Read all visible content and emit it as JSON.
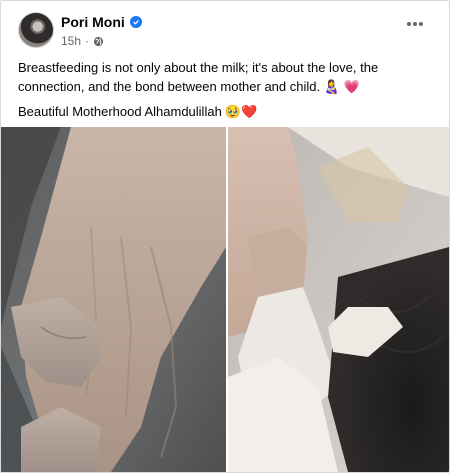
{
  "post": {
    "author": "Pori Moni",
    "timestamp": "15h",
    "audience_icon": "globe-icon",
    "verified_color": "#1877f2",
    "text_line1": "Breastfeeding is not only about the milk; it's about the love, the connection, and the bond between mother and child.",
    "text_line1_emojis": "👩‍🍼 💗",
    "text_line2": "Beautiful Motherhood Alhamdulillah",
    "text_line2_emojis": "🥹❤️"
  }
}
